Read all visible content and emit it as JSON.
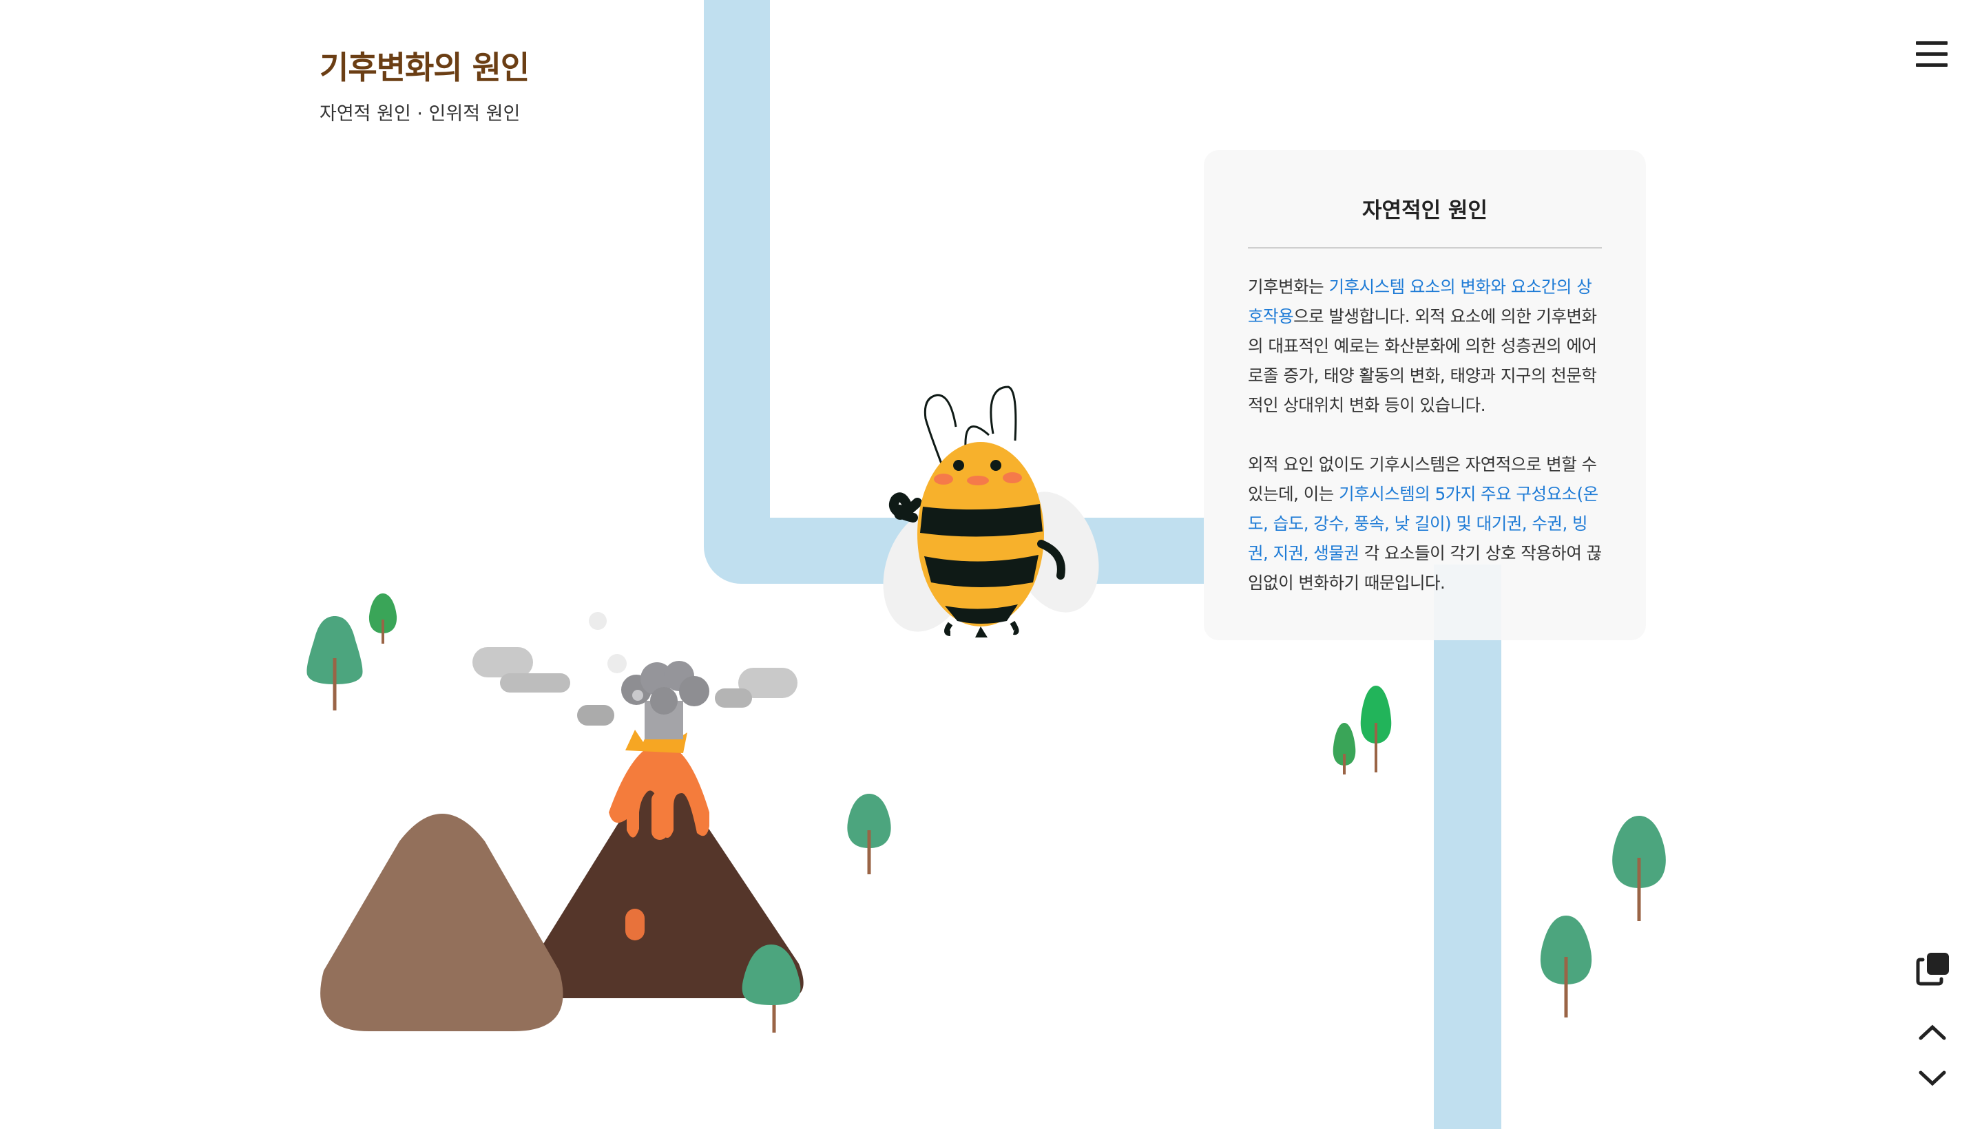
{
  "header": {
    "title": "기후변화의 원인",
    "subtitle": "자연적 원인 · 인위적 원인"
  },
  "info_card": {
    "title": "자연적인 원인",
    "paragraph1": {
      "pre": "기후변화는 ",
      "highlight": "기후시스템 요소의 변화와 요소간의 상호작용",
      "post": "으로 발생합니다. 외적 요소에 의한 기후변화의 대표적인 예로는 화산분화에 의한 성층권의 에어로졸 증가, 태양 활동의 변화, 태양과 지구의 천문학적인 상대위치 변화 등이 있습니다."
    },
    "paragraph2": {
      "pre": "외적 요인 없이도 기후시스템은 자연적으로 변할 수 있는데, 이는 ",
      "highlight": "기후시스템의 5가지 주요 구성요소(온도, 습도, 강수, 풍속, 낮 길이) 및 대기권, 수권, 빙권, 지권, 생물권",
      "post": " 각 요소들이 각기 상호 작용하여 끊임없이 변화하기 때문입니다."
    }
  },
  "controls": {
    "menu_icon": "hamburger-menu-icon",
    "copy_icon": "copy-icon",
    "up_icon": "chevron-up-icon",
    "down_icon": "chevron-down-icon"
  },
  "colors": {
    "title": "#6b3e14",
    "highlight": "#1e7bd6",
    "path": "#c0dfef",
    "bee_yellow": "#f7b12c",
    "lava": "#f47c3c",
    "volcano": "#55362a",
    "hill": "#93705b",
    "tree": "#4ca57e"
  }
}
